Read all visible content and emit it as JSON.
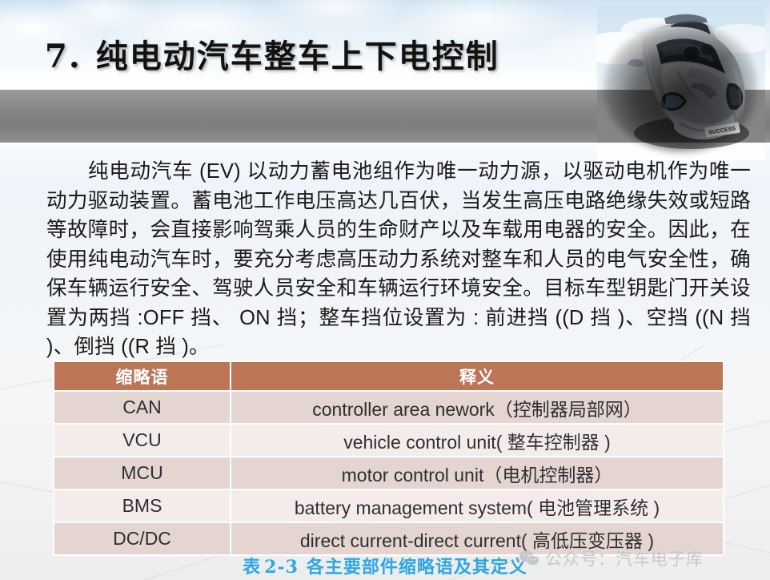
{
  "slide": {
    "title_number": "7.",
    "title_text": "纯电动汽车整车上下电控制",
    "body_paragraph": "纯电动汽车 (EV) 以动力蓄电池组作为唯一动力源，以驱动电机作为唯一动力驱动装置。蓄电池工作电压高达几百伏，当发生高压电路绝缘失效或短路等故障时，会直接影响驾乘人员的生命财产以及车载用电器的安全。因此，在使用纯电动汽车时，要充分考虑高压动力系统对整车和人员的电气安全性，确保车辆运行安全、驾驶人员安全和车辆运行环境安全。目标车型钥匙门开关设置为两挡 :OFF 挡、 ON 挡；整车挡位设置为 : 前进挡 ((D 挡 )、空挡 ((N 挡 )、倒挡 ((R 挡 )。",
    "caption_prefix": "表",
    "caption_number": "2-3",
    "caption_text": "各主要部件缩略语及其定义",
    "license_plate": "SUCCESS"
  },
  "table": {
    "headers": [
      "缩略语",
      "释义"
    ],
    "rows": [
      {
        "abbr": "CAN",
        "meaning": "controller area nework（控制器局部网）"
      },
      {
        "abbr": "VCU",
        "meaning": "vehicle control unit( 整车控制器 )"
      },
      {
        "abbr": "MCU",
        "meaning": "motor control unit（电机控制器）"
      },
      {
        "abbr": "BMS",
        "meaning": "battery management system( 电池管理系统 )"
      },
      {
        "abbr": "DC/DC",
        "meaning": "direct current-direct current( 高低压变压器 )"
      }
    ]
  },
  "watermark": {
    "icon": "wechat-icon",
    "text": "公众号：汽车电子库"
  },
  "colors": {
    "table_header_bg": "#bd7558",
    "row_dark": "#e4d5d1",
    "row_light": "#f4eceb",
    "caption_blue": "#2ea6e6",
    "banner_gray": "#858585",
    "watermark_gray": "#c3c6c8"
  }
}
